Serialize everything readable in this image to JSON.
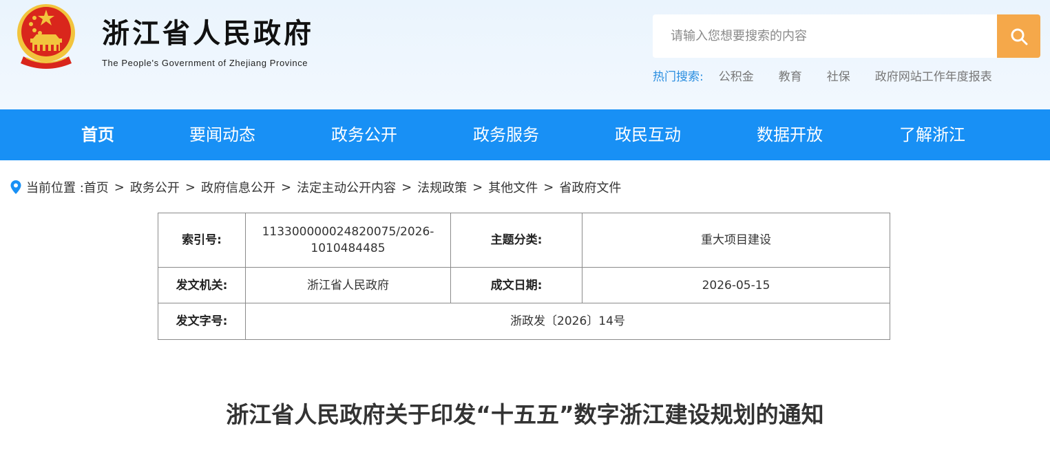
{
  "header": {
    "site_title": "浙江省人民政府",
    "site_subtitle": "The People's Government of Zhejiang Province",
    "search": {
      "placeholder": "请输入您想要搜索的内容",
      "value": ""
    },
    "hot_search": {
      "label": "热门搜索:",
      "links": [
        "公积金",
        "教育",
        "社保",
        "政府网站工作年度报表"
      ]
    }
  },
  "nav": {
    "items": [
      {
        "label": "首页",
        "active": true
      },
      {
        "label": "要闻动态"
      },
      {
        "label": "政务公开"
      },
      {
        "label": "政务服务"
      },
      {
        "label": "政民互动"
      },
      {
        "label": "数据开放"
      },
      {
        "label": "了解浙江"
      }
    ]
  },
  "breadcrumb": {
    "prefix": "当前位置 :",
    "items": [
      "首页",
      "政务公开",
      "政府信息公开",
      "法定主动公开内容",
      "法规政策",
      "其他文件",
      "省政府文件"
    ],
    "separator": ">"
  },
  "info": {
    "index_label": "索引号:",
    "index_value_line1": "113300000024820075/2026-",
    "index_value_line2": "1010484485",
    "topic_label": "主题分类:",
    "topic_value": "重大项目建设",
    "issuer_label": "发文机关:",
    "issuer_value": "浙江省人民政府",
    "date_label": "成文日期:",
    "date_value": "2026-05-15",
    "doc_no_label": "发文字号:",
    "doc_no_value": "浙政发〔2026〕14号"
  },
  "document": {
    "title": "浙江省人民政府关于印发“十五五”数字浙江建设规划的通知"
  },
  "colors": {
    "nav_bg": "#1890f5",
    "search_button": "#f5a84a",
    "hot_label": "#2a8ee0",
    "emblem_red": "#d9261c",
    "emblem_gold": "#f2c43d"
  }
}
